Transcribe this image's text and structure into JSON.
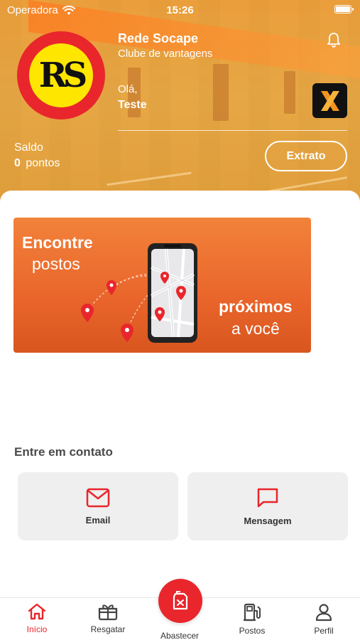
{
  "status_bar": {
    "carrier": "Operadora",
    "time": "15:26"
  },
  "header": {
    "brand_name": "Rede Socape",
    "brand_subtitle": "Clube de vantagens",
    "greeting": "Olá,",
    "user_name": "Teste",
    "logo_text": "RS",
    "saldo_label": "Saldo",
    "saldo_value": "0",
    "saldo_unit": "pontos",
    "extrato_label": "Extrato"
  },
  "banner": {
    "line1": "Encontre",
    "line2": "postos",
    "line3": "próximos",
    "line4": "a você"
  },
  "contact": {
    "title": "Entre em contato",
    "email_label": "Email",
    "message_label": "Mensagem"
  },
  "tabbar": {
    "items": [
      {
        "label": "Início",
        "icon": "home-icon"
      },
      {
        "label": "Resgatar",
        "icon": "gift-icon"
      },
      {
        "label": "Abastecer",
        "icon": "fuel-icon"
      },
      {
        "label": "Postos",
        "icon": "gas-station-icon"
      },
      {
        "label": "Perfil",
        "icon": "user-icon"
      }
    ]
  },
  "colors": {
    "accent": "#e8262c",
    "banner_orange": "#ec6a2d",
    "header_orange": "#eca03c"
  }
}
